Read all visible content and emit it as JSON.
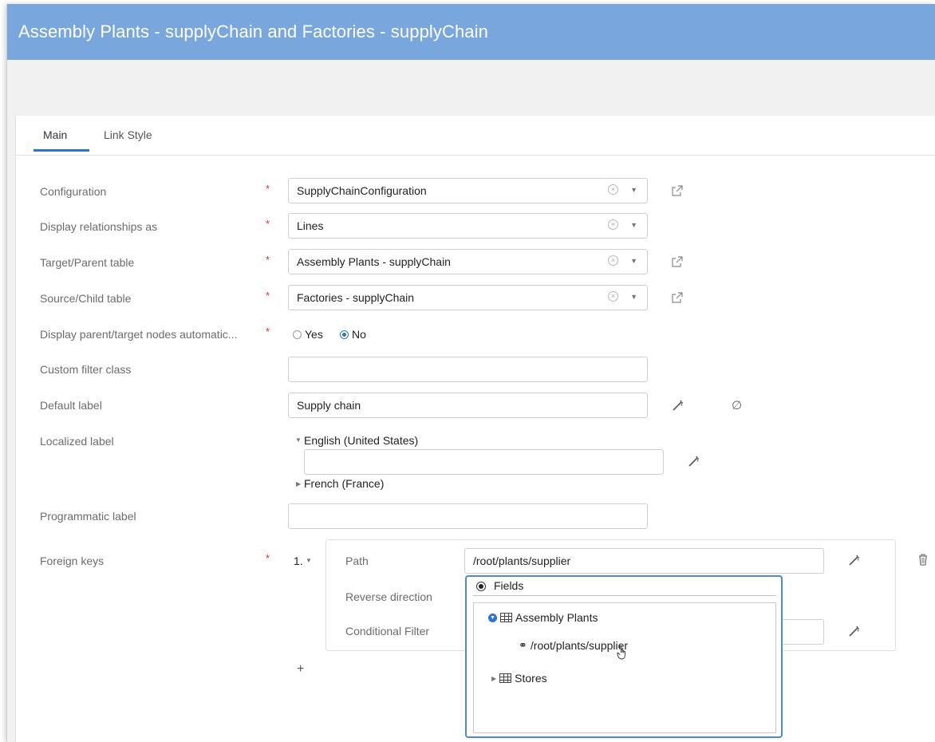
{
  "window": {
    "title": "Assembly Plants - supplyChain and Factories - supplyChain"
  },
  "tabs": [
    {
      "label": "Main",
      "active": true
    },
    {
      "label": "Link Style",
      "active": false
    }
  ],
  "form": {
    "configuration": {
      "label": "Configuration",
      "value": "SupplyChainConfiguration"
    },
    "display_relationships": {
      "label": "Display relationships as",
      "value": "Lines"
    },
    "target_table": {
      "label": "Target/Parent table",
      "value": "Assembly Plants - supplyChain"
    },
    "source_table": {
      "label": "Source/Child table",
      "value": "Factories - supplyChain"
    },
    "display_parent": {
      "label": "Display parent/target nodes automatic...",
      "options": [
        "Yes",
        "No"
      ],
      "selected": "No"
    },
    "custom_filter": {
      "label": "Custom filter class",
      "value": ""
    },
    "default_label": {
      "label": "Default label",
      "value": "Supply chain"
    },
    "localized_label": {
      "label": "Localized label",
      "english": "English (United States)",
      "english_value": "",
      "french": "French (France)"
    },
    "programmatic_label": {
      "label": "Programmatic label",
      "value": ""
    },
    "foreign_keys": {
      "label": "Foreign keys",
      "index": "1.",
      "path_label": "Path",
      "path_value": "/root/plants/supplier",
      "reverse_label": "Reverse direction",
      "conditional_label": "Conditional Filter",
      "add": "+"
    },
    "required_marker": "*"
  },
  "popup": {
    "header": "Fields",
    "tree": [
      {
        "label": "Assembly Plants",
        "expanded": true,
        "children": [
          {
            "label": "/root/plants/supplier"
          }
        ]
      },
      {
        "label": "Stores",
        "expanded": false
      }
    ]
  },
  "colors": {
    "titlebar": "#7aa6de",
    "accent": "#2e74c7",
    "required": "#d9322b"
  },
  "icons": [
    "clear-icon",
    "dropdown-caret-icon",
    "external-link-icon",
    "magic-wand-icon",
    "null-icon",
    "trash-icon",
    "table-icon",
    "link-icon"
  ]
}
